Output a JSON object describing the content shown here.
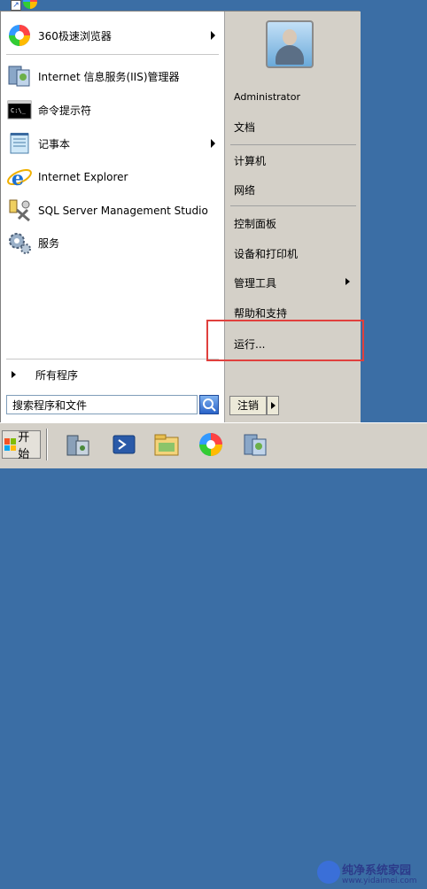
{
  "left_programs": [
    {
      "label": "360极速浏览器",
      "icon": "360-browser-icon",
      "has_arrow": true
    },
    {
      "label": "Internet 信息服务(IIS)管理器",
      "icon": "iis-manager-icon",
      "has_arrow": false
    },
    {
      "label": "命令提示符",
      "icon": "command-prompt-icon",
      "has_arrow": false
    },
    {
      "label": "记事本",
      "icon": "notepad-icon",
      "has_arrow": true
    },
    {
      "label": "Internet Explorer",
      "icon": "internet-explorer-icon",
      "has_arrow": false
    },
    {
      "label": "SQL Server Management Studio",
      "icon": "sql-server-icon",
      "has_arrow": false
    },
    {
      "label": "服务",
      "icon": "services-gear-icon",
      "has_arrow": false
    }
  ],
  "all_programs": "所有程序",
  "search": {
    "placeholder": "搜索程序和文件",
    "value": "搜索程序和文件"
  },
  "right_items": {
    "user": "Administrator",
    "documents": "文档",
    "computer": "计算机",
    "network": "网络",
    "control_panel": "控制面板",
    "devices": "设备和打印机",
    "admin_tools": "管理工具",
    "help": "帮助和支持",
    "run": "运行..."
  },
  "logoff": "注销",
  "start": "开始",
  "watermark": {
    "title": "纯净系统家园",
    "url": "www.yidaimei.com"
  },
  "colors": {
    "highlight_box": "#e0403d",
    "desktop": "#3b6ea5"
  }
}
